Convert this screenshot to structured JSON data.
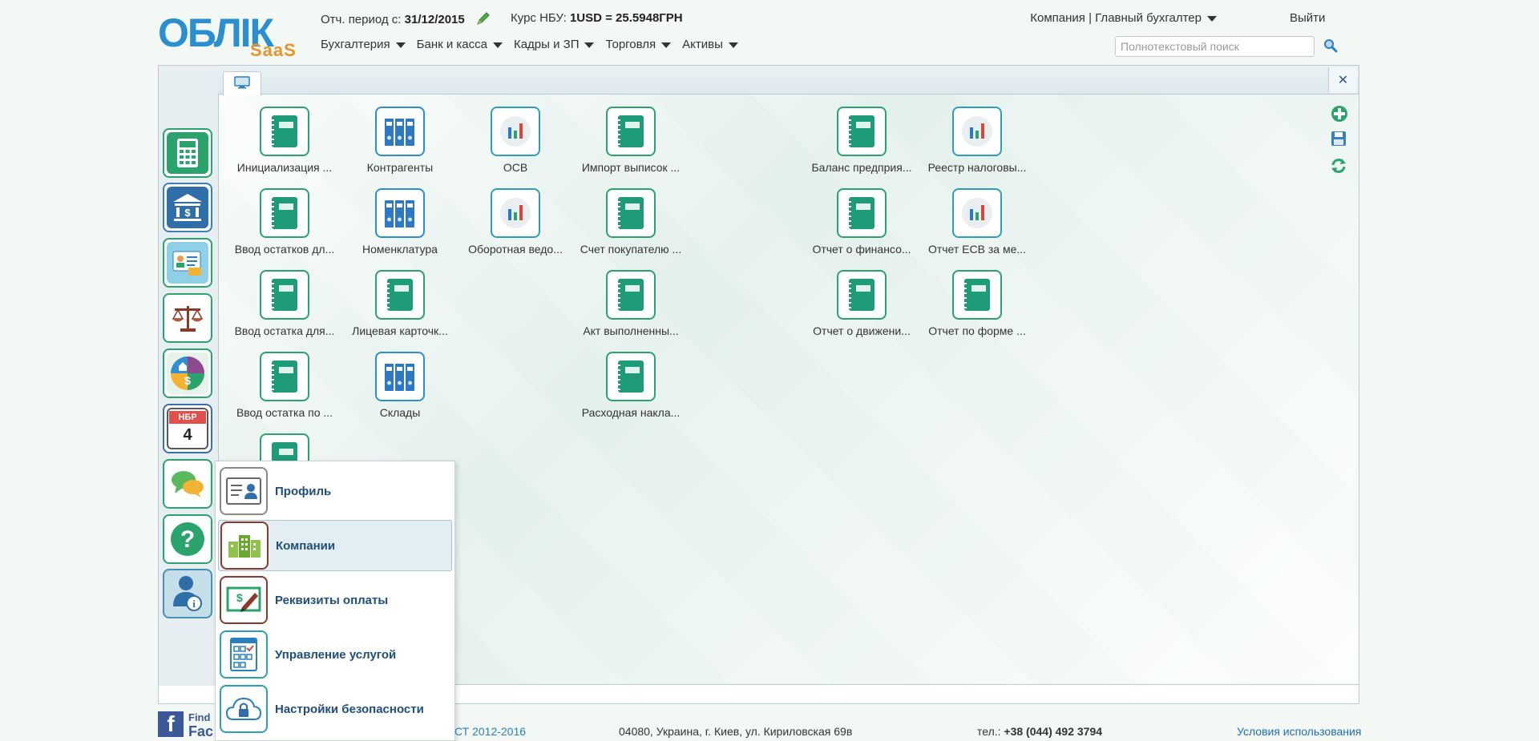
{
  "logo": {
    "main": "ОБЛІК",
    "sub": "SaaS"
  },
  "header": {
    "period_label": "Отч. период с:",
    "period_value": "31/12/2015",
    "rate_label": "Курс НБУ:",
    "rate_value": "1USD = 25.5948ГРН",
    "user_menu": "Компания | Главный бухгалтер",
    "logout": "Выйти",
    "search_placeholder": "Полнотекстовый поиск"
  },
  "menu": [
    {
      "label": "Бухгалтерия"
    },
    {
      "label": "Банк и касса"
    },
    {
      "label": "Кадры и ЗП"
    },
    {
      "label": "Торговля"
    },
    {
      "label": "Активы"
    }
  ],
  "sidebar": {
    "items": [
      {
        "name": "calculator-icon"
      },
      {
        "name": "bank-icon"
      },
      {
        "name": "staff-card-icon"
      },
      {
        "name": "scales-icon"
      },
      {
        "name": "assets-icon"
      },
      {
        "name": "calendar-icon",
        "badge": "НБР",
        "day": "4"
      },
      {
        "name": "chat-icon"
      },
      {
        "name": "help-icon"
      },
      {
        "name": "user-info-icon"
      }
    ]
  },
  "desktop": {
    "col1": [
      "Инициализация ...",
      "Ввод остатков дл...",
      "Ввод остатка для...",
      "Ввод остатка по ..."
    ],
    "col2": [
      "Контрагенты",
      "Номенклатура",
      "Лицевая карточк...",
      "Склады"
    ],
    "col3": [
      "ОСВ",
      "Оборотная ведо..."
    ],
    "col4": [
      "Импорт выписок ...",
      "Счет покупателю ...",
      "Акт выполненны...",
      "Расходная накла..."
    ],
    "col5": [
      "Баланс предприя...",
      "Отчет о финансо...",
      "Отчет о движени..."
    ],
    "col6": [
      "Реестр налоговы...",
      "Отчет ЕСВ за ме...",
      "Отчет по форме ..."
    ]
  },
  "popup": {
    "items": [
      {
        "label": "Профиль"
      },
      {
        "label": "Компании"
      },
      {
        "label": "Реквизиты оплаты"
      },
      {
        "label": "Управление услугой"
      },
      {
        "label": "Настройки безопасности"
      }
    ]
  },
  "footer": {
    "fb_text1": "Find",
    "fb_text2": "Fac",
    "copyright": "СТ 2012-2016",
    "address": "04080, Украина, г. Киев, ул. Кириловская 69в",
    "phone_label": "тел.:",
    "phone": "+38 (044) 492 3794",
    "terms": "Условия использования"
  },
  "colors": {
    "accent_green": "#2aa46c",
    "accent_blue": "#2a8fd0",
    "link": "#1f4e79"
  }
}
